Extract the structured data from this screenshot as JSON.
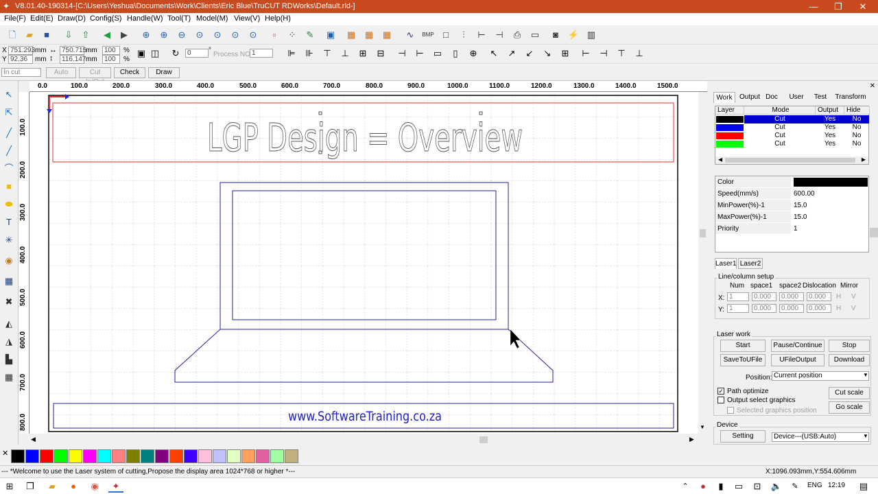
{
  "window": {
    "title": "V8.01.40-190314-[C:\\Users\\Yeshua\\Documents\\Work\\Clients\\Eric Blue\\TruCUT RDWorks\\Default.rld-]",
    "minimize": "—",
    "restore": "❐",
    "close": "✕"
  },
  "menu": [
    "File(F)",
    "Edit(E)",
    "Draw(D)",
    "Config(S)",
    "Handle(W)",
    "Tool(T)",
    "Model(M)",
    "View(V)",
    "Help(H)"
  ],
  "toolbar2": {
    "x_label": "X",
    "y_label": "Y",
    "x_value": "751.293",
    "y_value": "92.36",
    "mm": "mm",
    "w_value": "750.715",
    "h_value": "116.147",
    "scale_w": "100",
    "scale_h": "100",
    "pct": "%",
    "rotate_value": "0",
    "deg": "°",
    "process_label": "Process NO:",
    "process_value": "1"
  },
  "toolbar3": {
    "mode_select": "In cut",
    "auto": "Auto",
    "cut_in_out": "Cut In/Out",
    "check": "Check",
    "draw": "Draw"
  },
  "ruler": {
    "h": [
      "0.0",
      "100.0",
      "200.0",
      "300.0",
      "400.0",
      "500.0",
      "600.0",
      "700.0",
      "800.0",
      "900.0",
      "1000.0",
      "1100.0",
      "1200.0",
      "1300.0",
      "1400.0",
      "1500.0"
    ],
    "v": [
      "100.0",
      "200.0",
      "300.0",
      "400.0",
      "500.0",
      "600.0",
      "700.0",
      "800.0"
    ]
  },
  "canvas": {
    "title_text": "LGP Design = Overview",
    "url_text": "www.SoftwareTraining.co.za",
    "colors": {
      "red": "#e03030",
      "blue": "#2020a0",
      "grid": "#c8c8c8"
    }
  },
  "palette": [
    "#000000",
    "#0000ff",
    "#ff0000",
    "#00ff00",
    "#ffff00",
    "#ff00ff",
    "#00ffff",
    "#ff8080",
    "#808000",
    "#008080",
    "#800080",
    "#ff4000",
    "#4000ff",
    "#ffc0e0",
    "#c0c0ff",
    "#e0ffc0",
    "#ffa060",
    "#e060a0",
    "#a0ffa0",
    "#c0b080"
  ],
  "panel": {
    "tabs": [
      "Work",
      "Output",
      "Doc",
      "User",
      "Test",
      "Transform"
    ],
    "layer_headers": [
      "Layer",
      "Mode",
      "Output",
      "Hide"
    ],
    "layers": [
      {
        "color": "#000000",
        "mode": "Cut",
        "output": "Yes",
        "hide": "No"
      },
      {
        "color": "#0000ff",
        "mode": "Cut",
        "output": "Yes",
        "hide": "No"
      },
      {
        "color": "#ff0000",
        "mode": "Cut",
        "output": "Yes",
        "hide": "No"
      },
      {
        "color": "#00ff00",
        "mode": "Cut",
        "output": "Yes",
        "hide": "No"
      }
    ],
    "props": [
      {
        "key": "Color",
        "value": ""
      },
      {
        "key": "Speed(mm/s)",
        "value": "600.00"
      },
      {
        "key": "MinPower(%)-1",
        "value": "15.0"
      },
      {
        "key": "MaxPower(%)-1",
        "value": "15.0"
      },
      {
        "key": "Priority",
        "value": "1"
      }
    ],
    "laser_tabs": [
      "Laser1",
      "Laser2"
    ],
    "linecol": {
      "title": "Line/column setup",
      "headers": [
        "Num",
        "space1",
        "space2",
        "Dislocation",
        "Mirror"
      ],
      "x_label": "X:",
      "y_label": "Y:",
      "x_num": "1",
      "x_s1": "0.000",
      "x_s2": "0.000",
      "x_dis": "0.000",
      "y_num": "1",
      "y_s1": "0.000",
      "y_s2": "0.000",
      "y_dis": "0.000",
      "h": "H",
      "v": "V"
    },
    "laserwork": {
      "title": "Laser work",
      "start": "Start",
      "pause": "Pause/Continue",
      "stop": "Stop",
      "save_u": "SaveToUFile",
      "ufile_out": "UFileOutput",
      "download": "Download",
      "position_label": "Position:",
      "position_value": "Current position",
      "path_optimize": "Path optimize",
      "output_select": "Output select graphics",
      "selected_pos": "Selected graphics position",
      "cut_scale": "Cut scale",
      "go_scale": "Go scale"
    },
    "device": {
      "title": "Device",
      "setting": "Setting",
      "device_value": "Device---(USB:Auto)"
    }
  },
  "status": {
    "message": "--- *Welcome to use the Laser system of cutting,Propose the display area 1024*768 or higher *---",
    "coords": "X:1096.093mm,Y:554.606mm"
  },
  "taskbar": {
    "lang": "ENG",
    "time": "12:19"
  }
}
